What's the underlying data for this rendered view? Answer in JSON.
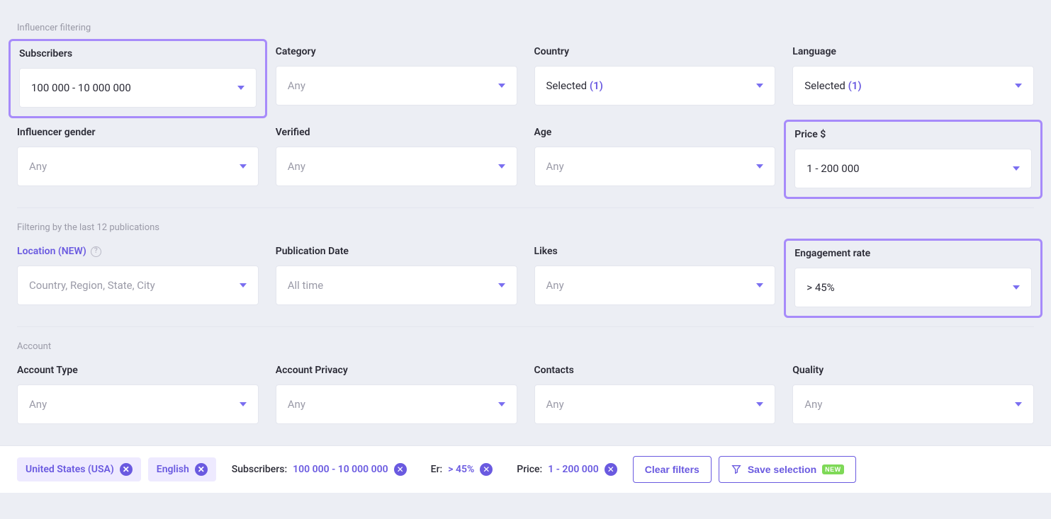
{
  "sections": {
    "influencer": {
      "title": "Influencer filtering"
    },
    "publications": {
      "title": "Filtering by the last 12 publications"
    },
    "account": {
      "title": "Account"
    }
  },
  "filters": {
    "subscribers": {
      "label": "Subscribers",
      "value": "100 000 - 10 000 000"
    },
    "category": {
      "label": "Category",
      "value": "Any"
    },
    "country": {
      "label": "Country",
      "selected_text": "Selected",
      "count": "(1)"
    },
    "language": {
      "label": "Language",
      "selected_text": "Selected",
      "count": "(1)"
    },
    "gender": {
      "label": "Influencer gender",
      "value": "Any"
    },
    "verified": {
      "label": "Verified",
      "value": "Any"
    },
    "age": {
      "label": "Age",
      "value": "Any"
    },
    "price": {
      "label": "Price $",
      "value": "1 - 200 000"
    },
    "location": {
      "label": "Location (NEW)",
      "placeholder": "Country, Region, State, City"
    },
    "pubdate": {
      "label": "Publication Date",
      "value": "All time"
    },
    "likes": {
      "label": "Likes",
      "value": "Any"
    },
    "engagement": {
      "label": "Engagement rate",
      "value": "> 45%"
    },
    "account_type": {
      "label": "Account Type",
      "value": "Any"
    },
    "account_privacy": {
      "label": "Account Privacy",
      "value": "Any"
    },
    "contacts": {
      "label": "Contacts",
      "value": "Any"
    },
    "quality": {
      "label": "Quality",
      "value": "Any"
    }
  },
  "chips": {
    "country": "United States (USA)",
    "language": "English",
    "subs_label": "Subscribers:",
    "subs_value": "100 000 - 10 000 000",
    "er_label": "Er:",
    "er_value": "> 45%",
    "price_label": "Price:",
    "price_value": "1 - 200 000"
  },
  "buttons": {
    "clear": "Clear filters",
    "save": "Save selection",
    "new_badge": "NEW"
  }
}
